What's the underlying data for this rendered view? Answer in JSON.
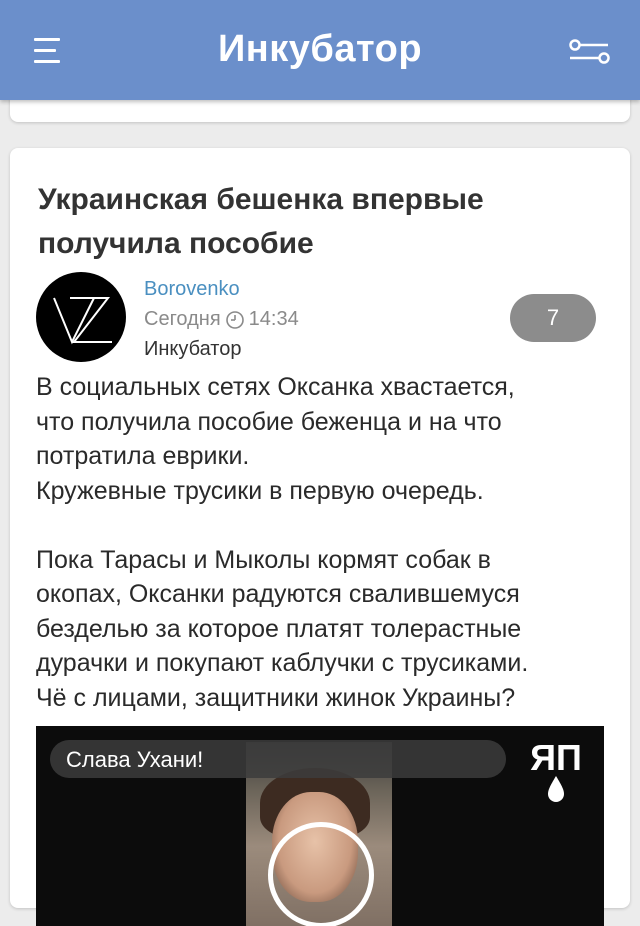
{
  "header": {
    "title": "Инкубатор",
    "menu_icon": "hamburger-menu-icon",
    "filter_icon": "filter-sliders-icon",
    "background": "#6b8fcb"
  },
  "post": {
    "title": "Украинская бешенка впервые получила пособие",
    "author": "Borovenko",
    "time": "Сегодня",
    "clock": "14:34",
    "community": "Инкубатор",
    "comments_count": "7",
    "body": [
      "В социальных сетях Оксанка хвастается,",
      "что получила пособие беженца и на что",
      "потратила еврики.",
      "Кружевные трусики в первую очередь.",
      "",
      "Пока Тарасы и Мыколы кормят собак в",
      "окопах, Оксанки радуются свалившемуся",
      "безделью за которое платят толерастные",
      "дурачки и покупают каблучки с трусиками.",
      "Чё с лицами, защитники жинок Украины?"
    ],
    "video": {
      "title": "Слава Ухани!",
      "logo_text": "ЯП"
    }
  }
}
